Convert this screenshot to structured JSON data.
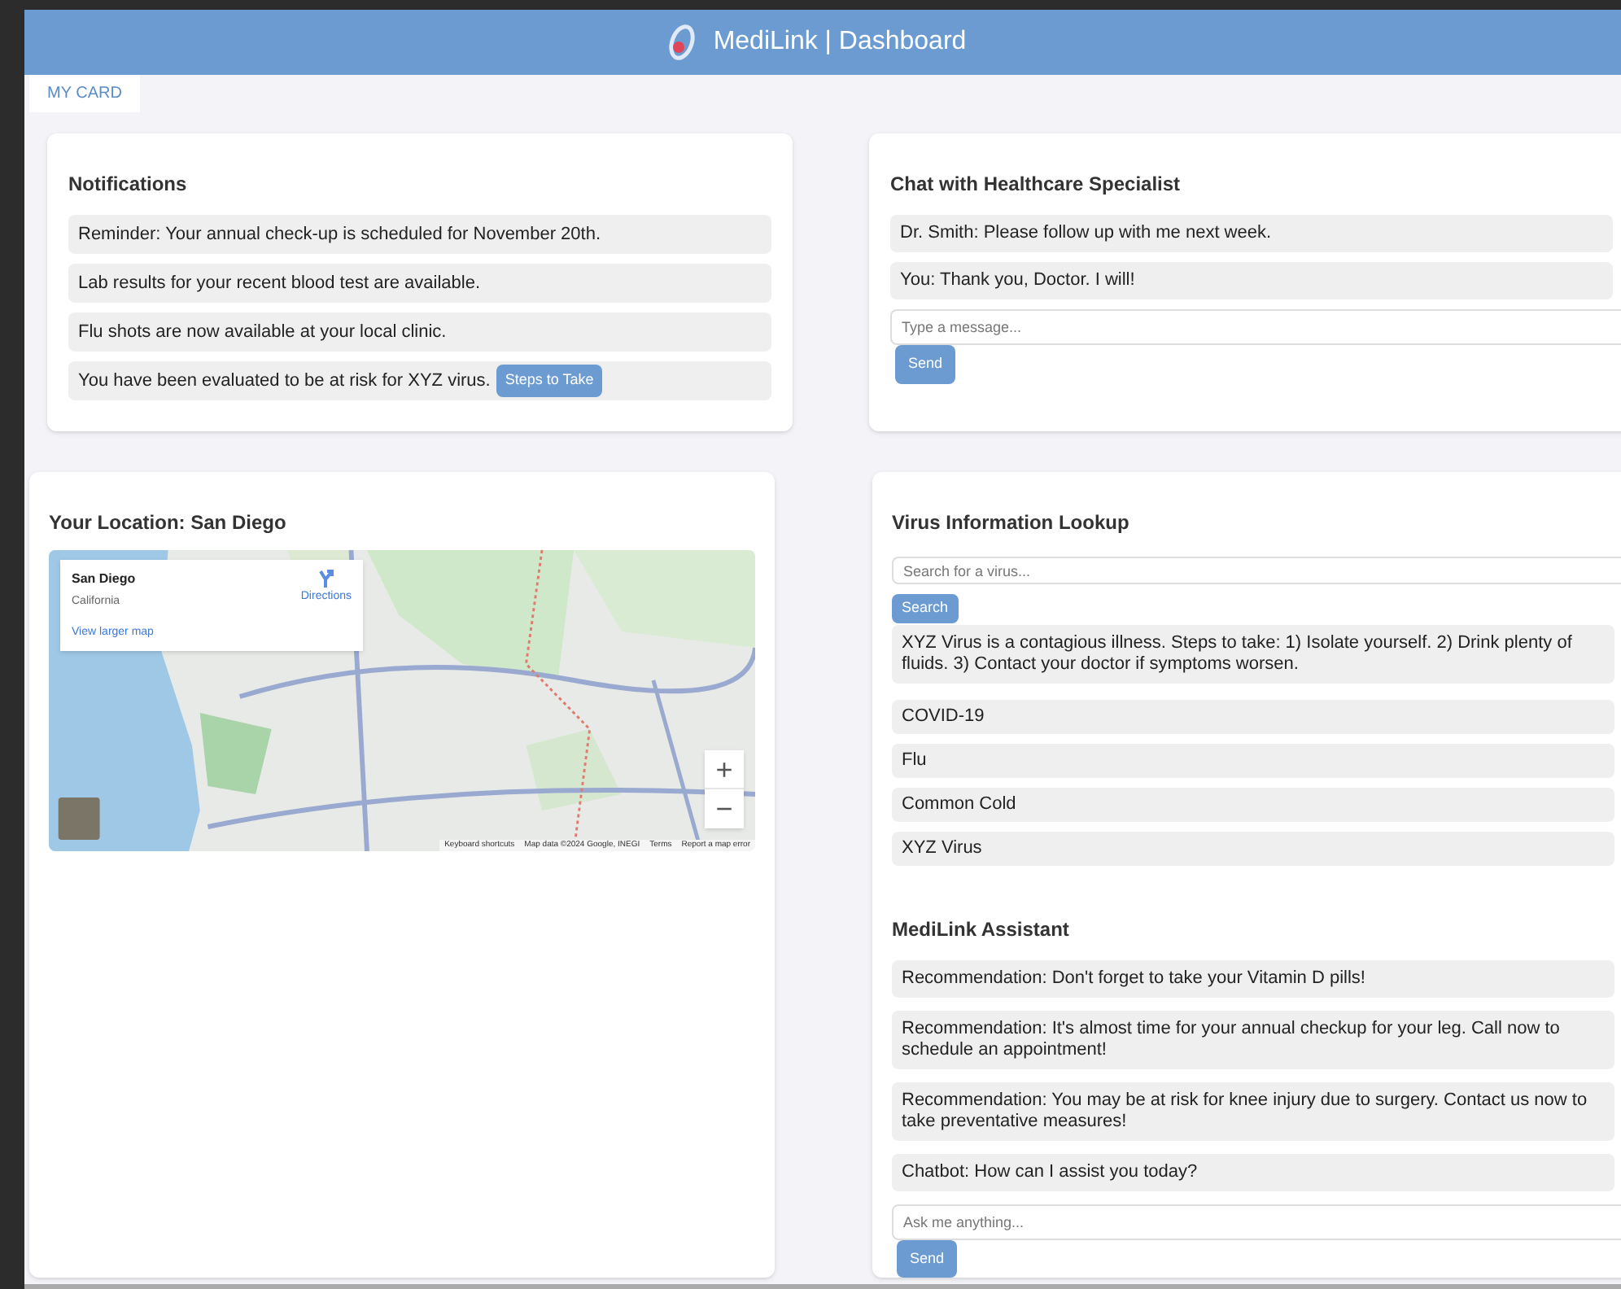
{
  "header": {
    "title": "MediLink | Dashboard"
  },
  "tabs": [
    {
      "label": "MY CARD",
      "selected": true
    }
  ],
  "notifications": {
    "title": "Notifications",
    "items": [
      {
        "text": "Reminder: Your annual check-up is scheduled for November 20th."
      },
      {
        "text": "Lab results for your recent blood test are available."
      },
      {
        "text": "Flu shots are now available at your local clinic."
      },
      {
        "text": "You have been evaluated to be at risk for XYZ virus.",
        "action": "Steps to Take"
      }
    ]
  },
  "chat": {
    "title": "Chat with Healthcare Specialist",
    "messages": [
      "Dr. Smith: Please follow up with me next week.",
      "You: Thank you, Doctor. I will!"
    ],
    "placeholder": "Type a message...",
    "button": "Send"
  },
  "location": {
    "title": "Your Location: San Diego",
    "map": {
      "kind": "picture",
      "place": "San Diego",
      "region": "California",
      "directions": "Directions",
      "larger_map": "View larger map",
      "zoom_in": "+",
      "zoom_out": "−",
      "footer": [
        "Keyboard shortcuts",
        "Map data ©2024 Google, INEGI",
        "Terms",
        "Report a map error"
      ]
    }
  },
  "virus_lookup": {
    "title": "Virus Information Lookup",
    "placeholder": "Search for a virus...",
    "button": "Search",
    "result": "XYZ Virus is a contagious illness. Steps to take: 1) Isolate yourself. 2) Drink plenty of fluids. 3) Contact your doctor if symptoms worsen.",
    "viruses": [
      "COVID-19",
      "Flu",
      "Common Cold",
      "XYZ Virus"
    ]
  },
  "assistant": {
    "title": "MediLink Assistant",
    "messages": [
      "Recommendation: Don't forget to take your Vitamin D pills!",
      "Recommendation: It's almost time for your annual checkup for your leg. Call now to schedule an appointment!",
      "Recommendation: You may be at risk for knee injury due to surgery. Contact us now to take preventative measures!",
      "Chatbot: How can I assist you today?"
    ],
    "placeholder": "Ask me anything...",
    "button": "Send"
  }
}
